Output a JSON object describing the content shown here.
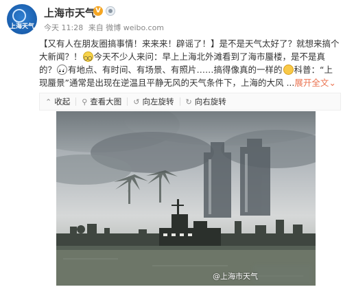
{
  "header": {
    "avatar_text": "上海天气",
    "name": "上海市天气",
    "badge_v": "V",
    "time": "今天 11:28",
    "source": "来自 微博 weibo.com"
  },
  "post": {
    "seg1": "【又有人在朋友圈搞事情！来来来！辟谣了！】是不是天气太好了？就想来搞个大新闻？！",
    "seg2": "今天不少人来问：早上上海北外滩看到了海市蜃楼，是不是真的？",
    "seg3": "有地点、有时间、有场景、有照片……搞得像真的一样的",
    "seg4": "科普：“上现蜃景”通常是出现在逆温且平静无风的天气条件下，上海的大风 ...",
    "more": "展开全文",
    "more_caret": "⌄"
  },
  "toolbar": {
    "collect": "收起",
    "view_large": "查看大图",
    "rotate_left": "向左旋转",
    "rotate_right": "向右旋转"
  },
  "image": {
    "watermark": "@上海市天气"
  },
  "icons": {
    "collect": "collapse-icon",
    "view_large": "magnifier-icon",
    "rotate_left": "rotate-left-icon",
    "rotate_right": "rotate-right-icon"
  },
  "colors": {
    "link": "#eb7350",
    "text": "#333333",
    "meta": "#888888",
    "badge": "#f5a623"
  }
}
